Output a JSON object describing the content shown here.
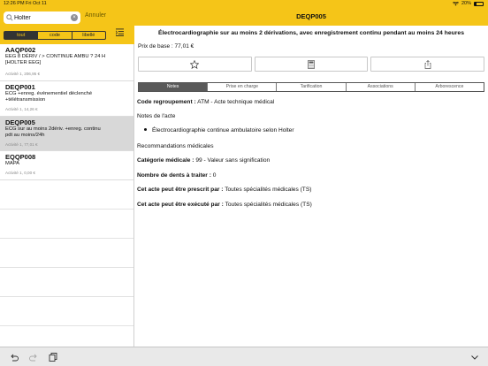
{
  "status_bar": {
    "time": "12:26 PM",
    "date": "Fri Oct 11",
    "battery": "20%",
    "battery_level": 0.2
  },
  "search": {
    "value": "Holter",
    "placeholder": "",
    "cancel_label": "Annuler"
  },
  "filter_segments": [
    {
      "label": "tout",
      "active": true
    },
    {
      "label": "code",
      "active": false
    },
    {
      "label": "libellé",
      "active": false
    }
  ],
  "results": [
    {
      "code": "AAQP002",
      "desc1": "EEG 8 DÉRIV / > CONTINUE AMBU ? 24 H",
      "desc2": "[HOLTER EEG]",
      "meta": "Activité 1, 206,95 €",
      "selected": false
    },
    {
      "code": "DEQP001",
      "desc1": "ECG +enreg. événementiel déclenché",
      "desc2": "+télétransmission",
      "meta": "Activité 1, 14,26 €",
      "selected": false
    },
    {
      "code": "DEQP005",
      "desc1": "ECG sur au moins 2dériv. +enreg. continu",
      "desc2": "pdt au moins/24h",
      "meta": "Activité 1, 77,01 €",
      "selected": true
    },
    {
      "code": "EQQP008",
      "desc1": "MAPA",
      "desc2": "",
      "meta": "Activité 1, 0,00 €",
      "selected": false
    }
  ],
  "detail": {
    "code": "DEQP005",
    "title": "Électrocardiographie sur au moins 2 dérivations, avec enregistrement continu pendant au moins 24 heures",
    "base_price": "Prix de base : 77,01 €",
    "tabs": [
      {
        "label": "Notes",
        "active": true
      },
      {
        "label": "Prise en charge",
        "active": false
      },
      {
        "label": "Tarification",
        "active": false
      },
      {
        "label": "Associations",
        "active": false
      },
      {
        "label": "Arborescence",
        "active": false
      }
    ],
    "regroupement_label": "Code regroupement :",
    "regroupement_value": "ATM - Acte technique médical",
    "notes_heading": "Notes de l'acte",
    "note_bullet": "Électrocardiographie continue ambulatoire selon Holter",
    "recommandations": "Recommandations médicales",
    "categorie_label": "Catégorie médicale :",
    "categorie_value": "99 - Valeur sans signification",
    "dents_label": "Nombre de dents à traiter :",
    "dents_value": "0",
    "prescrit_label": "Cet acte peut être prescrit par :",
    "prescrit_value": "Toutes spécialités médicales (TS)",
    "execute_label": "Cet acte peut être exécuté par :",
    "execute_value": "Toutes spécialités médicales (TS)"
  },
  "colors": {
    "accent": "#f5c518",
    "selected_row": "#d8d8d8",
    "active_tab": "#5a5a5a"
  },
  "icons": [
    "search-icon",
    "clear-icon",
    "list-order-icon",
    "star-icon",
    "calculator-icon",
    "share-icon",
    "undo-icon",
    "redo-icon",
    "clipboard-icon",
    "chevron-down-icon"
  ]
}
